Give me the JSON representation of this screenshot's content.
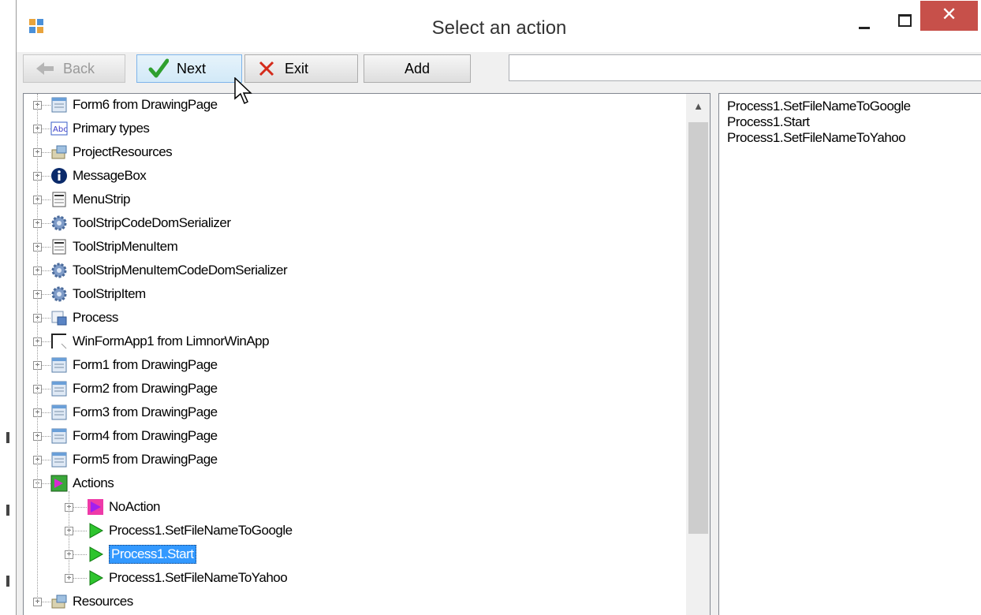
{
  "window": {
    "title": "Select an action"
  },
  "title_buttons": {
    "close_glyph": "✕"
  },
  "toolbar": {
    "back_label": "Back",
    "next_label": "Next",
    "exit_label": "Exit",
    "add_label": "Add",
    "search_value": ""
  },
  "tree": {
    "items": [
      {
        "label": "Form6 from DrawingPage",
        "icon": "form-icon"
      },
      {
        "label": "Primary types",
        "icon": "abc-icon"
      },
      {
        "label": "ProjectResources",
        "icon": "resources-icon"
      },
      {
        "label": "MessageBox",
        "icon": "info-icon"
      },
      {
        "label": "MenuStrip",
        "icon": "menu-icon"
      },
      {
        "label": "ToolStripCodeDomSerializer",
        "icon": "gear-icon"
      },
      {
        "label": "ToolStripMenuItem",
        "icon": "menu-icon"
      },
      {
        "label": "ToolStripMenuItemCodeDomSerializer",
        "icon": "gear-icon"
      },
      {
        "label": "ToolStripItem",
        "icon": "gear-icon"
      },
      {
        "label": "Process",
        "icon": "process-icon"
      },
      {
        "label": "WinFormApp1 from LimnorWinApp",
        "icon": "window-icon"
      },
      {
        "label": "Form1 from DrawingPage",
        "icon": "form-icon"
      },
      {
        "label": "Form2 from DrawingPage",
        "icon": "form-icon"
      },
      {
        "label": "Form3 from DrawingPage",
        "icon": "form-icon"
      },
      {
        "label": "Form4 from DrawingPage",
        "icon": "form-icon"
      },
      {
        "label": "Form5 from DrawingPage",
        "icon": "form-icon"
      },
      {
        "label": "Actions",
        "icon": "actions-icon",
        "expanded": true
      },
      {
        "label": "NoAction",
        "icon": "noaction-icon",
        "child": true
      },
      {
        "label": "Process1.SetFileNameToGoogle",
        "icon": "play-icon",
        "child": true
      },
      {
        "label": "Process1.Start",
        "icon": "play-icon",
        "child": true,
        "selected": true
      },
      {
        "label": "Process1.SetFileNameToYahoo",
        "icon": "play-icon",
        "child": true
      },
      {
        "label": "Resources",
        "icon": "resources-icon"
      }
    ]
  },
  "selected_actions": [
    "Process1.SetFileNameToGoogle",
    "Process1.Start",
    "Process1.SetFileNameToYahoo"
  ],
  "colors": {
    "selection": "#3399ff",
    "close_button": "#c7504a",
    "next_button": "#d2e9f8"
  }
}
